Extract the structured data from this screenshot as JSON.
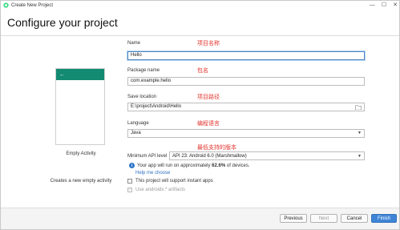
{
  "window": {
    "title": "Create New Project",
    "controls": [
      "—",
      "☐",
      "✕"
    ]
  },
  "header": {
    "title": "Configure your project"
  },
  "preview": {
    "back_icon": "←",
    "activity_name": "Empty Activity",
    "activity_desc": "Creates a new empty activity"
  },
  "form": {
    "name_label": "Name",
    "name_value": "Hello",
    "package_label": "Package name",
    "package_value": "com.example.hello",
    "save_label": "Save location",
    "save_value": "E:\\project\\Android\\Hello",
    "language_label": "Language",
    "language_value": "Java",
    "min_api_label": "Minimum API level",
    "min_api_value": "API 23: Android 6.0 (Marshmallow)",
    "info_text_prefix": "Your app will run on approximately ",
    "info_percent": "62.6%",
    "info_text_suffix": " of devices.",
    "help_link": "Help me choose",
    "instant_apps_label": "This project will support instant apps",
    "androidx_label": "Use androidx.* artifacts"
  },
  "annotations": {
    "name": "项目名称",
    "package": "包名",
    "location": "项目路径",
    "language": "编程语言",
    "min_api": "最低支持的版本"
  },
  "footer": {
    "previous": "Previous",
    "next": "Next",
    "cancel": "Cancel",
    "finish": "Finish"
  },
  "colors": {
    "accent": "#138a72",
    "annotation": "#e3342f",
    "link": "#2d6fc4",
    "primary_button": "#3f85d6"
  }
}
